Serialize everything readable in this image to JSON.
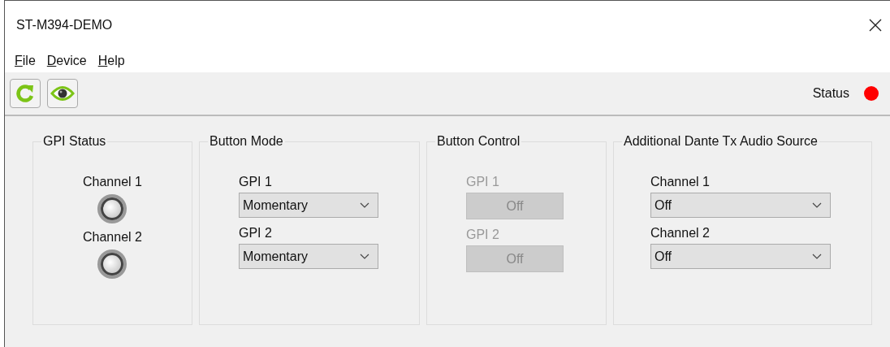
{
  "window": {
    "title": "ST-M394-DEMO"
  },
  "menu": [
    "File",
    "Device",
    "Help"
  ],
  "toolbar": {
    "buttons": [
      {
        "kind": "refresh"
      },
      {
        "kind": "view"
      }
    ],
    "status": {
      "label": "Status",
      "color": "#ff0000"
    }
  },
  "gpi_status": {
    "title": "GPI Status",
    "channels": [
      {
        "label": "Channel 1",
        "on": false
      },
      {
        "label": "Channel 2",
        "on": false
      }
    ]
  },
  "button_mode": {
    "title": "Button Mode",
    "fields": [
      {
        "label": "GPI 1",
        "value": "Momentary"
      },
      {
        "label": "GPI 2",
        "value": "Momentary"
      }
    ]
  },
  "button_control": {
    "title": "Button Control",
    "buttons": [
      {
        "label": "GPI 1",
        "text": "Off",
        "disabled": true
      },
      {
        "label": "GPI 2",
        "text": "Off",
        "disabled": true
      }
    ]
  },
  "audio_source": {
    "title": "Additional Dante Tx Audio Source",
    "fields": [
      {
        "label": "Channel 1",
        "value": "Off"
      },
      {
        "label": "Channel 2",
        "value": "Off"
      }
    ]
  }
}
